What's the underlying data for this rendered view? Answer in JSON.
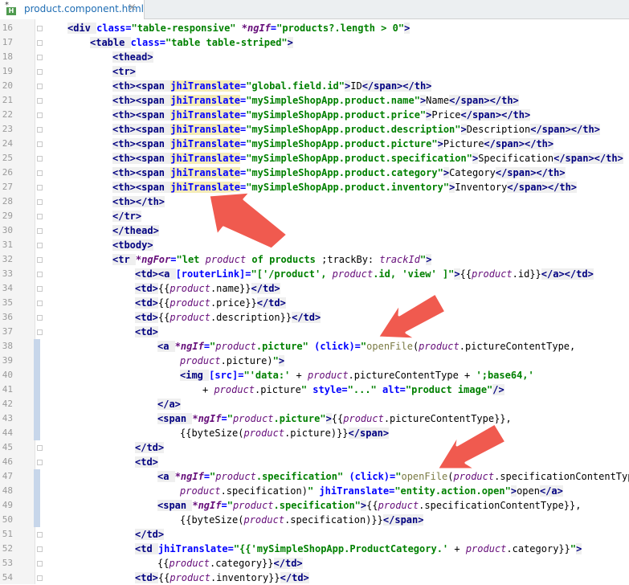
{
  "tab": {
    "label": "product.component.html"
  },
  "lines": [
    {
      "n": "16",
      "i": 1,
      "s": [
        [
          "tag",
          "<div "
        ],
        [
          "attr",
          "class="
        ],
        [
          "str",
          "\"table-responsive\" "
        ],
        [
          "ng",
          "*ngIf"
        ],
        [
          "attr",
          "="
        ],
        [
          "str",
          "\"products?.length > 0\""
        ],
        [
          "tag",
          ">"
        ]
      ]
    },
    {
      "n": "17",
      "i": 2,
      "s": [
        [
          "tag",
          "<table "
        ],
        [
          "attr",
          "class="
        ],
        [
          "str",
          "\"table table-striped\""
        ],
        [
          "tag",
          ">"
        ]
      ]
    },
    {
      "n": "18",
      "i": 3,
      "s": [
        [
          "tag",
          "<thead>"
        ]
      ]
    },
    {
      "n": "19",
      "i": 3,
      "s": [
        [
          "tag",
          "<tr>"
        ]
      ]
    },
    {
      "n": "20",
      "i": 3,
      "s": [
        [
          "tag",
          "<th><span "
        ],
        [
          "attr hl",
          "jhiTranslate"
        ],
        [
          "attr",
          "="
        ],
        [
          "str",
          "\"global.field.id\""
        ],
        [
          "tag",
          ">"
        ],
        [
          "t",
          "ID"
        ],
        [
          "tag",
          "</span></th>"
        ]
      ]
    },
    {
      "n": "21",
      "i": 3,
      "s": [
        [
          "tag",
          "<th><span "
        ],
        [
          "attr hl",
          "jhiTranslate"
        ],
        [
          "attr",
          "="
        ],
        [
          "str",
          "\"mySimpleShopApp.product.name\""
        ],
        [
          "tag",
          ">"
        ],
        [
          "t",
          "Name"
        ],
        [
          "tag",
          "</span></th>"
        ]
      ]
    },
    {
      "n": "22",
      "i": 3,
      "s": [
        [
          "tag",
          "<th><span "
        ],
        [
          "attr hl",
          "jhiTranslate"
        ],
        [
          "attr",
          "="
        ],
        [
          "str",
          "\"mySimpleShopApp.product.price\""
        ],
        [
          "tag",
          ">"
        ],
        [
          "t",
          "Price"
        ],
        [
          "tag",
          "</span></th>"
        ]
      ]
    },
    {
      "n": "23",
      "i": 3,
      "s": [
        [
          "tag",
          "<th><span "
        ],
        [
          "attr hl",
          "jhiTranslate"
        ],
        [
          "attr",
          "="
        ],
        [
          "str",
          "\"mySimpleShopApp.product.description\""
        ],
        [
          "tag",
          ">"
        ],
        [
          "t",
          "Description"
        ],
        [
          "tag",
          "</span></th>"
        ]
      ]
    },
    {
      "n": "24",
      "i": 3,
      "s": [
        [
          "tag",
          "<th><span "
        ],
        [
          "attr hl",
          "jhiTranslate"
        ],
        [
          "attr",
          "="
        ],
        [
          "str",
          "\"mySimpleShopApp.product.picture\""
        ],
        [
          "tag",
          ">"
        ],
        [
          "t",
          "Picture"
        ],
        [
          "tag",
          "</span></th>"
        ]
      ]
    },
    {
      "n": "25",
      "i": 3,
      "s": [
        [
          "tag",
          "<th><span "
        ],
        [
          "attr hl",
          "jhiTranslate"
        ],
        [
          "attr",
          "="
        ],
        [
          "str",
          "\"mySimpleShopApp.product.specification\""
        ],
        [
          "tag",
          ">"
        ],
        [
          "t",
          "Specification"
        ],
        [
          "tag",
          "</span></th>"
        ]
      ]
    },
    {
      "n": "26",
      "i": 3,
      "s": [
        [
          "tag",
          "<th><span "
        ],
        [
          "attr hl",
          "jhiTranslate"
        ],
        [
          "attr",
          "="
        ],
        [
          "str",
          "\"mySimpleShopApp.product.category\""
        ],
        [
          "tag",
          ">"
        ],
        [
          "t",
          "Category"
        ],
        [
          "tag",
          "</span></th>"
        ]
      ]
    },
    {
      "n": "27",
      "i": 3,
      "s": [
        [
          "tag",
          "<th><span "
        ],
        [
          "attr hl",
          "jhiTranslate"
        ],
        [
          "attr",
          "="
        ],
        [
          "str",
          "\"mySimpleShopApp.product.inventory\""
        ],
        [
          "tag",
          ">"
        ],
        [
          "t",
          "Inventory"
        ],
        [
          "tag",
          "</span></th>"
        ]
      ]
    },
    {
      "n": "28",
      "i": 3,
      "s": [
        [
          "tag",
          "<th></th>"
        ]
      ]
    },
    {
      "n": "29",
      "i": 3,
      "s": [
        [
          "tag",
          "</tr>"
        ]
      ]
    },
    {
      "n": "30",
      "i": 3,
      "s": [
        [
          "tag",
          "</thead>"
        ]
      ]
    },
    {
      "n": "31",
      "i": 3,
      "s": [
        [
          "tag",
          "<tbody>"
        ]
      ]
    },
    {
      "n": "32",
      "i": 3,
      "s": [
        [
          "tag",
          "<tr "
        ],
        [
          "ng",
          "*ngFor"
        ],
        [
          "attr",
          "="
        ],
        [
          "str",
          "\"let "
        ],
        [
          "ai",
          "product"
        ],
        [
          "str",
          " of products "
        ],
        [
          "t",
          ";trackBy: "
        ],
        [
          "ai",
          "trackId"
        ],
        [
          "str",
          "\""
        ],
        [
          "tag",
          ">"
        ]
      ]
    },
    {
      "n": "33",
      "i": 4,
      "s": [
        [
          "tag",
          "<td><a "
        ],
        [
          "attr",
          "[routerLink]="
        ],
        [
          "str",
          "\"['/product', "
        ],
        [
          "ai",
          "product"
        ],
        [
          "str",
          ".id, 'view' ]\""
        ],
        [
          "tag",
          ">"
        ],
        [
          "t",
          "{{"
        ],
        [
          "ai",
          "product"
        ],
        [
          "t",
          ".id}}"
        ],
        [
          "tag",
          "</a></td>"
        ]
      ]
    },
    {
      "n": "34",
      "i": 4,
      "s": [
        [
          "tag",
          "<td>"
        ],
        [
          "t",
          "{{"
        ],
        [
          "ai",
          "product"
        ],
        [
          "t",
          ".name}}"
        ],
        [
          "tag",
          "</td>"
        ]
      ]
    },
    {
      "n": "35",
      "i": 4,
      "s": [
        [
          "tag",
          "<td>"
        ],
        [
          "t",
          "{{"
        ],
        [
          "ai",
          "product"
        ],
        [
          "t",
          ".price}}"
        ],
        [
          "tag",
          "</td>"
        ]
      ]
    },
    {
      "n": "36",
      "i": 4,
      "s": [
        [
          "tag",
          "<td>"
        ],
        [
          "t",
          "{{"
        ],
        [
          "ai",
          "product"
        ],
        [
          "t",
          ".description}}"
        ],
        [
          "tag",
          "</td>"
        ]
      ]
    },
    {
      "n": "37",
      "i": 4,
      "s": [
        [
          "tag",
          "<td>"
        ]
      ]
    },
    {
      "n": "38",
      "i": 5,
      "c": true,
      "s": [
        [
          "tag",
          "<a "
        ],
        [
          "ng",
          "*ngIf"
        ],
        [
          "attr",
          "="
        ],
        [
          "str",
          "\""
        ],
        [
          "ai",
          "product"
        ],
        [
          "str",
          ".picture\" "
        ],
        [
          "attr",
          "(click)="
        ],
        [
          "str",
          "\""
        ],
        [
          "fn",
          "openFile"
        ],
        [
          "t",
          "("
        ],
        [
          "ai",
          "product"
        ],
        [
          "t",
          ".pictureContentType,"
        ]
      ]
    },
    {
      "n": "39",
      "i": 6,
      "c": true,
      "s": [
        [
          "ai",
          "product"
        ],
        [
          "t",
          ".picture)"
        ],
        [
          "str",
          "\""
        ],
        [
          "tag",
          ">"
        ]
      ]
    },
    {
      "n": "40",
      "i": 6,
      "c": true,
      "s": [
        [
          "tag",
          "<img "
        ],
        [
          "attr",
          "[src]="
        ],
        [
          "str",
          "\"'data:' "
        ],
        [
          "t",
          "+ "
        ],
        [
          "ai",
          "product"
        ],
        [
          "t",
          ".pictureContentType + "
        ],
        [
          "str",
          "';base64,'"
        ]
      ]
    },
    {
      "n": "41",
      "i": 7,
      "c": true,
      "s": [
        [
          "t",
          "+ "
        ],
        [
          "ai",
          "product"
        ],
        [
          "t",
          ".picture"
        ],
        [
          "str",
          "\" "
        ],
        [
          "attr",
          "style="
        ],
        [
          "str",
          "\"...\" "
        ],
        [
          "attr",
          "alt="
        ],
        [
          "str",
          "\"product image\""
        ],
        [
          "tag",
          "/>"
        ]
      ]
    },
    {
      "n": "42",
      "i": 5,
      "c": true,
      "s": [
        [
          "tag",
          "</a>"
        ]
      ]
    },
    {
      "n": "43",
      "i": 5,
      "c": true,
      "s": [
        [
          "tag",
          "<span "
        ],
        [
          "ng",
          "*ngIf"
        ],
        [
          "attr",
          "="
        ],
        [
          "str",
          "\""
        ],
        [
          "ai",
          "product"
        ],
        [
          "str",
          ".picture\""
        ],
        [
          "tag",
          ">"
        ],
        [
          "t",
          "{{"
        ],
        [
          "ai",
          "product"
        ],
        [
          "t",
          ".pictureContentType}},"
        ]
      ]
    },
    {
      "n": "44",
      "i": 6,
      "c": true,
      "s": [
        [
          "t",
          "{{byteSize("
        ],
        [
          "ai",
          "product"
        ],
        [
          "t",
          ".picture)}}"
        ],
        [
          "tag",
          "</span>"
        ]
      ]
    },
    {
      "n": "45",
      "i": 4,
      "s": [
        [
          "tag",
          "</td>"
        ]
      ]
    },
    {
      "n": "46",
      "i": 4,
      "s": [
        [
          "tag",
          "<td>"
        ]
      ]
    },
    {
      "n": "47",
      "i": 5,
      "c": true,
      "s": [
        [
          "tag",
          "<a "
        ],
        [
          "ng",
          "*ngIf"
        ],
        [
          "attr",
          "="
        ],
        [
          "str",
          "\""
        ],
        [
          "ai",
          "product"
        ],
        [
          "str",
          ".specification\" "
        ],
        [
          "attr",
          "(click)="
        ],
        [
          "str",
          "\""
        ],
        [
          "fn",
          "openFile"
        ],
        [
          "t",
          "("
        ],
        [
          "ai",
          "product"
        ],
        [
          "t",
          ".specificationContentType,"
        ]
      ]
    },
    {
      "n": "48",
      "i": 6,
      "c": true,
      "s": [
        [
          "ai",
          "product"
        ],
        [
          "t",
          ".specification)"
        ],
        [
          "str",
          "\" "
        ],
        [
          "attr",
          "jhiTranslate="
        ],
        [
          "str",
          "\"entity.action.open\""
        ],
        [
          "tag",
          ">"
        ],
        [
          "t",
          "open"
        ],
        [
          "tag",
          "</a>"
        ]
      ]
    },
    {
      "n": "49",
      "i": 5,
      "c": true,
      "s": [
        [
          "tag",
          "<span "
        ],
        [
          "ng",
          "*ngIf"
        ],
        [
          "attr",
          "="
        ],
        [
          "str",
          "\""
        ],
        [
          "ai",
          "product"
        ],
        [
          "str",
          ".specification\""
        ],
        [
          "tag",
          ">"
        ],
        [
          "t",
          "{{"
        ],
        [
          "ai",
          "product"
        ],
        [
          "t",
          ".specificationContentType}},"
        ]
      ]
    },
    {
      "n": "50",
      "i": 6,
      "c": true,
      "s": [
        [
          "t",
          "{{byteSize("
        ],
        [
          "ai",
          "product"
        ],
        [
          "t",
          ".specification)}}"
        ],
        [
          "tag",
          "</span>"
        ]
      ]
    },
    {
      "n": "51",
      "i": 4,
      "s": [
        [
          "tag",
          "</td>"
        ]
      ]
    },
    {
      "n": "52",
      "i": 4,
      "s": [
        [
          "tag",
          "<td "
        ],
        [
          "attr",
          "jhiTranslate="
        ],
        [
          "str",
          "\"{{'mySimpleShopApp.ProductCategory.' "
        ],
        [
          "t",
          "+ "
        ],
        [
          "ai",
          "product"
        ],
        [
          "t",
          ".category}}"
        ],
        [
          "str",
          "\""
        ],
        [
          "tag",
          ">"
        ]
      ]
    },
    {
      "n": "53",
      "i": 5,
      "s": [
        [
          "t",
          "{{"
        ],
        [
          "ai",
          "product"
        ],
        [
          "t",
          ".category}}"
        ],
        [
          "tag",
          "</td>"
        ]
      ]
    },
    {
      "n": "54",
      "i": 4,
      "s": [
        [
          "tag",
          "<td>"
        ],
        [
          "t",
          "{{"
        ],
        [
          "ai",
          "product"
        ],
        [
          "t",
          ".inventory}}"
        ],
        [
          "tag",
          "</td>"
        ]
      ]
    }
  ]
}
